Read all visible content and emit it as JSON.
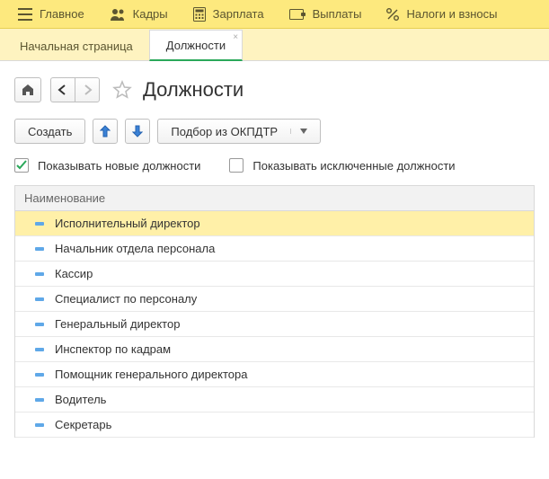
{
  "topmenu": [
    {
      "label": "Главное"
    },
    {
      "label": "Кадры"
    },
    {
      "label": "Зарплата"
    },
    {
      "label": "Выплаты"
    },
    {
      "label": "Налоги и взносы"
    }
  ],
  "tabs": {
    "home": "Начальная страница",
    "active": "Должности"
  },
  "page": {
    "title": "Должности"
  },
  "toolbar": {
    "create": "Создать",
    "okpdtr": "Подбор из ОКПДТР"
  },
  "checks": {
    "show_new": "Показывать новые должности",
    "show_excluded": "Показывать исключенные должности"
  },
  "table": {
    "header": "Наименование",
    "rows": [
      {
        "name": "Исполнительный директор",
        "selected": true
      },
      {
        "name": "Начальник отдела персонала"
      },
      {
        "name": "Кассир"
      },
      {
        "name": "Специалист по персоналу"
      },
      {
        "name": "Генеральный директор"
      },
      {
        "name": "Инспектор по кадрам"
      },
      {
        "name": "Помощник генерального директора"
      },
      {
        "name": "Водитель"
      },
      {
        "name": "Секретарь"
      }
    ]
  }
}
